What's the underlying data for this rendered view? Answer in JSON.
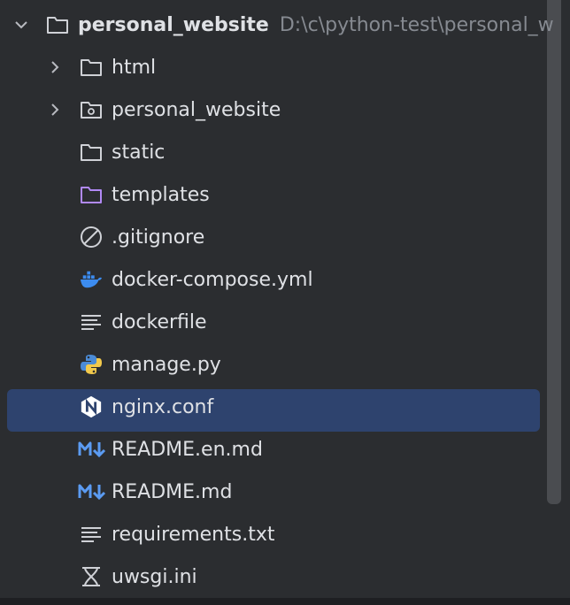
{
  "project": {
    "name": "personal_website",
    "path": "D:\\c\\python-test\\personal_w"
  },
  "items": [
    {
      "label": "html",
      "icon": "folder-icon"
    },
    {
      "label": "personal_website",
      "icon": "package-folder-icon"
    },
    {
      "label": "static",
      "icon": "folder-icon"
    },
    {
      "label": "templates",
      "icon": "templates-folder-icon"
    },
    {
      "label": ".gitignore",
      "icon": "ignore-icon"
    },
    {
      "label": "docker-compose.yml",
      "icon": "docker-icon"
    },
    {
      "label": "dockerfile",
      "icon": "text-lines-icon"
    },
    {
      "label": "manage.py",
      "icon": "python-icon"
    },
    {
      "label": "nginx.conf",
      "icon": "nginx-icon",
      "selected": true
    },
    {
      "label": "README.en.md",
      "icon": "markdown-icon"
    },
    {
      "label": "README.md",
      "icon": "markdown-icon"
    },
    {
      "label": "requirements.txt",
      "icon": "text-lines-icon"
    },
    {
      "label": "uwsgi.ini",
      "icon": "ini-icon"
    }
  ],
  "colors": {
    "background": "#2b2d30",
    "selection": "#2e436e",
    "text": "#dfe1e5",
    "path_text": "#868a91",
    "templates_folder": "#b189f5",
    "docker": "#3c8cf0",
    "markdown": "#5b9bf2"
  }
}
